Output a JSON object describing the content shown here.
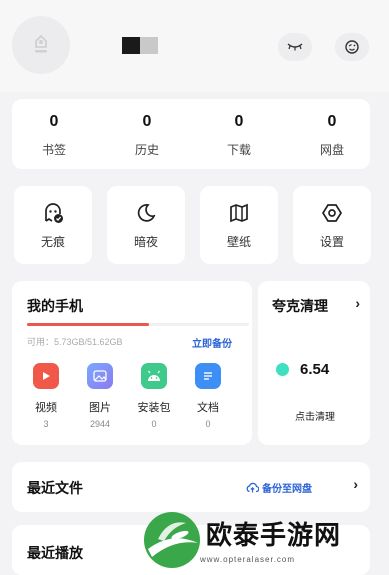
{
  "header": {
    "avatar_icon": "user-avatar-icon",
    "eye_icon": "eye-closed-icon",
    "emoji_icon": "skin-face-icon"
  },
  "stats": [
    {
      "value": "0",
      "label": "书签"
    },
    {
      "value": "0",
      "label": "历史"
    },
    {
      "value": "0",
      "label": "下载"
    },
    {
      "value": "0",
      "label": "网盘"
    }
  ],
  "tools": [
    {
      "label": "无痕",
      "icon": "ghost-icon"
    },
    {
      "label": "暗夜",
      "icon": "moon-icon"
    },
    {
      "label": "壁纸",
      "icon": "book-map-icon"
    },
    {
      "label": "设置",
      "icon": "settings-hexagon-icon"
    }
  ],
  "phone": {
    "title": "我的手机",
    "storage": "可用：5.73GB/51.62GB",
    "storage_used_fraction": 0.55,
    "backup_label": "立即备份",
    "categories": [
      {
        "name": "视频",
        "count": "3",
        "color": "#f0584a"
      },
      {
        "name": "图片",
        "count": "2944",
        "color": "#5b8ff0"
      },
      {
        "name": "安装包",
        "count": "0",
        "color": "#3fc98a"
      },
      {
        "name": "文档",
        "count": "0",
        "color": "#3d8ef5"
      }
    ]
  },
  "cleaner": {
    "title": "夸克清理",
    "value": "6.54",
    "button": "点击清理"
  },
  "recent_files": {
    "title": "最近文件",
    "backup_label": "备份至网盘"
  },
  "recent_play": {
    "title": "最近播放"
  },
  "watermark": {
    "text": "欧泰手游网",
    "url": "www.opteralaser.com"
  }
}
